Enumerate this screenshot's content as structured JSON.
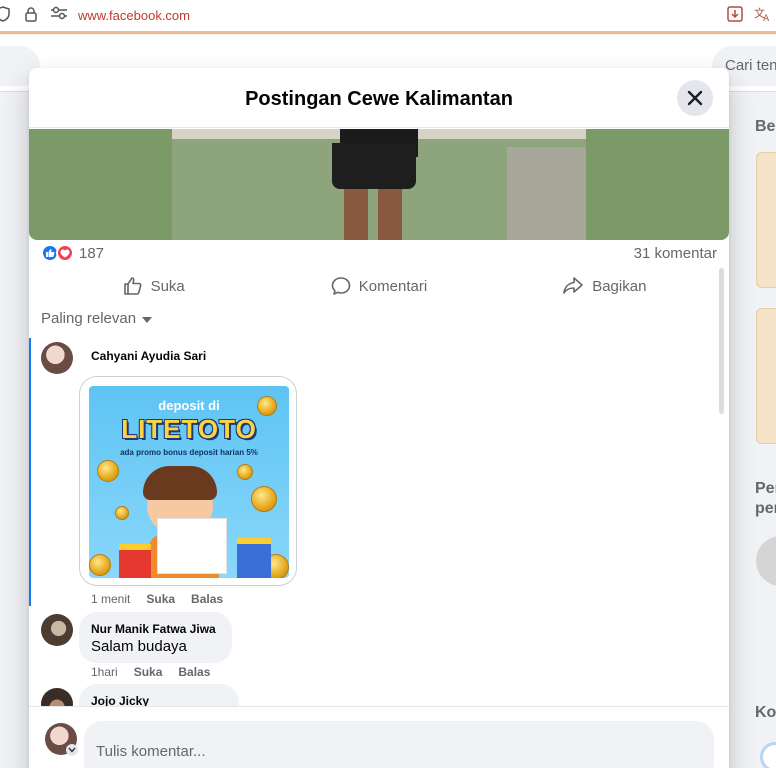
{
  "browser": {
    "url": "www.facebook.com"
  },
  "facebook": {
    "search_placeholder": "Cari ten",
    "right_column": {
      "heading1": "Ber",
      "heading2_line1": "Per",
      "heading2_line2": "per",
      "heading3": "Ko"
    }
  },
  "modal": {
    "title": "Postingan Cewe Kalimantan",
    "reactions": {
      "count": "187",
      "comments": "31 komentar"
    },
    "actions": {
      "like": "Suka",
      "comment": "Komentari",
      "share": "Bagikan"
    },
    "sort_label": "Paling relevan",
    "comments": [
      {
        "author": "Cahyani Ayudia Sari",
        "image": {
          "line1": "deposit di",
          "brand": "LITETOTO",
          "line2": "ada promo bonus deposit harian 5%"
        },
        "time": "1 menit",
        "like": "Suka",
        "reply": "Balas"
      },
      {
        "author": "Nur Manik Fatwa Jiwa",
        "text": "Salam budaya",
        "time": "1hari",
        "like": "Suka",
        "reply": "Balas"
      },
      {
        "author": "Jojo Jicky"
      }
    ],
    "composer": {
      "placeholder": "Tulis komentar..."
    }
  }
}
